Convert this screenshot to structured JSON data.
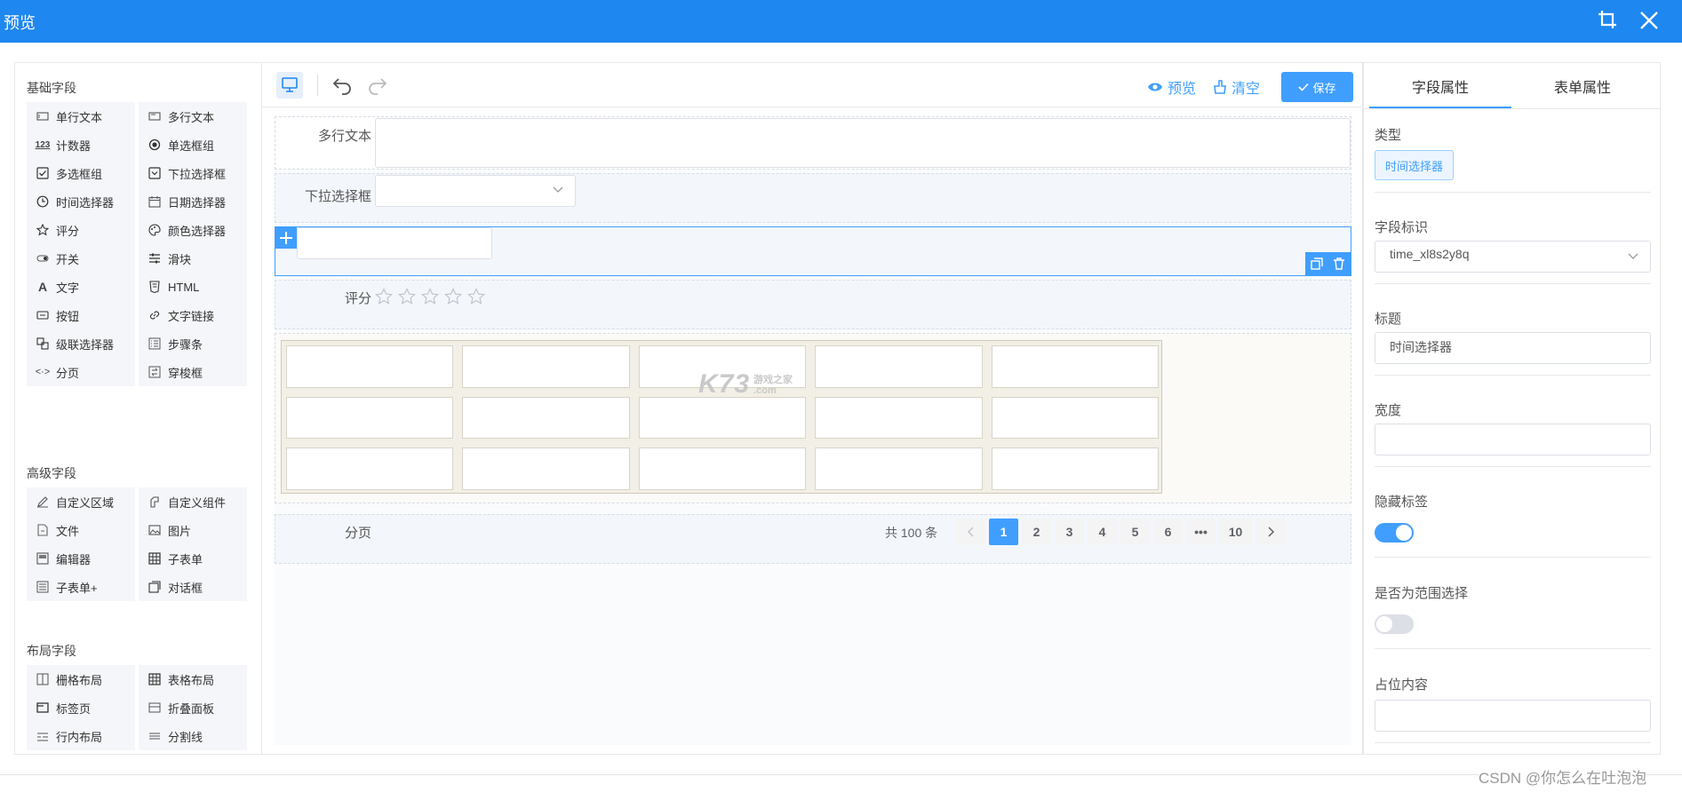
{
  "window": {
    "title": "预览",
    "crop_icon": "crop-icon",
    "close_icon": "close-icon"
  },
  "left_panel": {
    "basic_title": "基础字段",
    "basic": [
      {
        "label": "单行文本",
        "icon": "input-icon"
      },
      {
        "label": "多行文本",
        "icon": "textarea-icon"
      },
      {
        "label": "计数器",
        "icon": "number-icon"
      },
      {
        "label": "单选框组",
        "icon": "radio-icon"
      },
      {
        "label": "多选框组",
        "icon": "checkbox-icon"
      },
      {
        "label": "下拉选择框",
        "icon": "select-icon"
      },
      {
        "label": "时间选择器",
        "icon": "clock-icon"
      },
      {
        "label": "日期选择器",
        "icon": "calendar-icon"
      },
      {
        "label": "评分",
        "icon": "star-icon"
      },
      {
        "label": "颜色选择器",
        "icon": "palette-icon"
      },
      {
        "label": "开关",
        "icon": "switch-icon"
      },
      {
        "label": "滑块",
        "icon": "slider-icon"
      },
      {
        "label": "文字",
        "icon": "text-icon"
      },
      {
        "label": "HTML",
        "icon": "html-icon"
      },
      {
        "label": "按钮",
        "icon": "button-icon"
      },
      {
        "label": "文字链接",
        "icon": "link-icon"
      },
      {
        "label": "级联选择器",
        "icon": "cascader-icon"
      },
      {
        "label": "步骤条",
        "icon": "steps-icon"
      },
      {
        "label": "分页",
        "icon": "pagination-icon"
      },
      {
        "label": "穿梭框",
        "icon": "transfer-icon"
      }
    ],
    "advanced_title": "高级字段",
    "advanced": [
      {
        "label": "自定义区域",
        "icon": "pen-icon"
      },
      {
        "label": "自定义组件",
        "icon": "component-icon"
      },
      {
        "label": "文件",
        "icon": "file-icon"
      },
      {
        "label": "图片",
        "icon": "image-icon"
      },
      {
        "label": "编辑器",
        "icon": "editor-icon"
      },
      {
        "label": "子表单",
        "icon": "table-icon"
      },
      {
        "label": "子表单+",
        "icon": "subform-icon"
      },
      {
        "label": "对话框",
        "icon": "dialog-icon"
      }
    ],
    "layout_title": "布局字段",
    "layout": [
      {
        "label": "栅格布局",
        "icon": "grid-icon"
      },
      {
        "label": "表格布局",
        "icon": "table-layout-icon"
      },
      {
        "label": "标签页",
        "icon": "tabs-icon"
      },
      {
        "label": "折叠面板",
        "icon": "collapse-icon"
      },
      {
        "label": "行内布局",
        "icon": "inline-icon"
      },
      {
        "label": "分割线",
        "icon": "divider-icon"
      }
    ]
  },
  "toolbar": {
    "preview_label": "预览",
    "clear_label": "清空",
    "save_label": "保存"
  },
  "canvas": {
    "textarea_label": "多行文本",
    "select_label": "下拉选择框",
    "rate_label": "评分",
    "rate_value": 0,
    "rate_max": 5,
    "pagination_label": "分页",
    "total_text": "共 100 条",
    "pages": [
      "1",
      "2",
      "3",
      "4",
      "5",
      "6",
      "•••",
      "10"
    ],
    "current_page": "1",
    "watermark_main": "K73",
    "watermark_sub": "游戏之家",
    "watermark_domain": ".com"
  },
  "right_panel": {
    "tab_field": "字段属性",
    "tab_form": "表单属性",
    "type_label": "类型",
    "type_value": "时间选择器",
    "id_label": "字段标识",
    "id_value": "time_xl8s2y8q",
    "title_label": "标题",
    "title_value": "时间选择器",
    "width_label": "宽度",
    "width_value": "",
    "hide_label": "隐藏标签",
    "hide_value": true,
    "range_label": "是否为范围选择",
    "range_value": false,
    "placeholder_label": "占位内容",
    "placeholder_value": ""
  },
  "footer": {
    "credit": "CSDN @你怎么在吐泡泡"
  },
  "colors": {
    "primary": "#1e87f0",
    "link": "#409eff"
  }
}
